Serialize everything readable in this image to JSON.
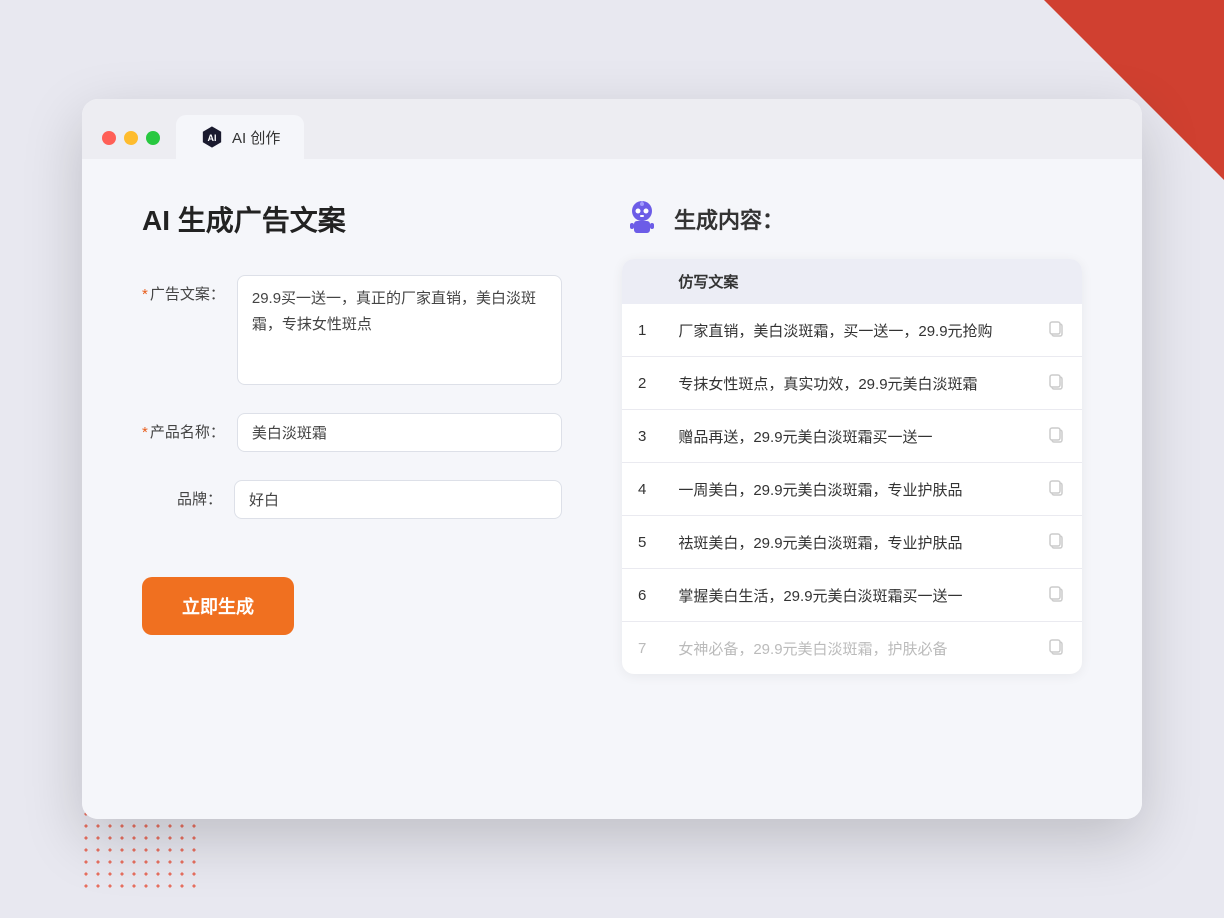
{
  "browser": {
    "tab_label": "AI 创作"
  },
  "page": {
    "title": "AI 生成广告文案",
    "result_title": "生成内容："
  },
  "form": {
    "ad_copy_label": "广告文案：",
    "ad_copy_value": "29.9买一送一，真正的厂家直销，美白淡斑霜，专抹女性斑点",
    "product_name_label": "产品名称：",
    "product_name_value": "美白淡斑霜",
    "brand_label": "品牌：",
    "brand_value": "好白",
    "generate_button": "立即生成",
    "required_star": "*"
  },
  "results": {
    "column_header": "仿写文案",
    "items": [
      {
        "id": 1,
        "text": "厂家直销，美白淡斑霜，买一送一，29.9元抢购",
        "dimmed": false
      },
      {
        "id": 2,
        "text": "专抹女性斑点，真实功效，29.9元美白淡斑霜",
        "dimmed": false
      },
      {
        "id": 3,
        "text": "赠品再送，29.9元美白淡斑霜买一送一",
        "dimmed": false
      },
      {
        "id": 4,
        "text": "一周美白，29.9元美白淡斑霜，专业护肤品",
        "dimmed": false
      },
      {
        "id": 5,
        "text": "祛斑美白，29.9元美白淡斑霜，专业护肤品",
        "dimmed": false
      },
      {
        "id": 6,
        "text": "掌握美白生活，29.9元美白淡斑霜买一送一",
        "dimmed": false
      },
      {
        "id": 7,
        "text": "女神必备，29.9元美白淡斑霜，护肤必备",
        "dimmed": true
      }
    ]
  }
}
